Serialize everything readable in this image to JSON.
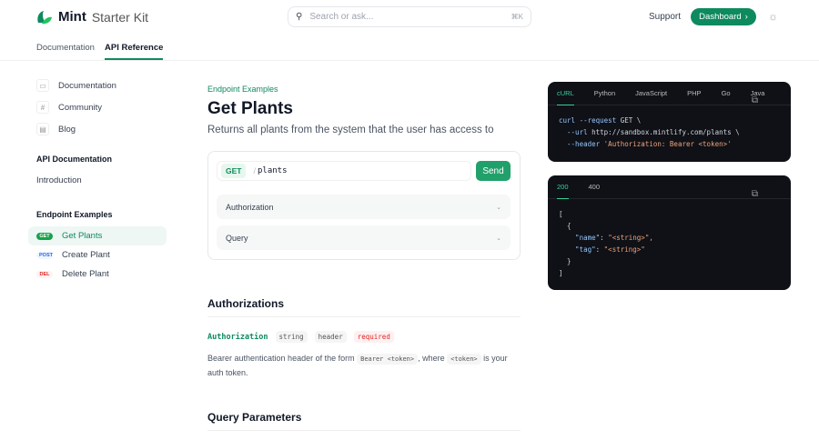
{
  "header": {
    "brand": "Mint",
    "subtitle": "Starter Kit",
    "search_placeholder": "Search or ask...",
    "search_shortcut": "⌘K",
    "support": "Support",
    "dashboard": "Dashboard",
    "dashboard_arrow": "›"
  },
  "tabs": [
    {
      "label": "Documentation"
    },
    {
      "label": "API Reference"
    }
  ],
  "sidebar": {
    "links": [
      {
        "label": "Documentation",
        "icon": "book-icon"
      },
      {
        "label": "Community",
        "icon": "slack-icon"
      },
      {
        "label": "Blog",
        "icon": "newspaper-icon"
      }
    ],
    "section1": "API Documentation",
    "intro": "Introduction",
    "section2": "Endpoint Examples",
    "endpoints": [
      {
        "method": "GET",
        "label": "Get Plants"
      },
      {
        "method": "POST",
        "label": "Create Plant"
      },
      {
        "method": "DEL",
        "label": "Delete Plant"
      }
    ]
  },
  "main": {
    "eyebrow": "Endpoint Examples",
    "title": "Get Plants",
    "description": "Returns all plants from the system that the user has access to",
    "method": "GET",
    "sep": "/",
    "path": "plants",
    "send": "Send",
    "accordions": [
      "Authorization",
      "Query"
    ],
    "auth_heading": "Authorizations",
    "param_name": "Authorization",
    "param_type": "string",
    "param_loc": "header",
    "param_req": "required",
    "desc_1": "Bearer authentication header of the form ",
    "code_1": "Bearer <token>",
    "desc_2": ", where ",
    "code_2": "<token>",
    "desc_3": " is your auth token.",
    "query_heading": "Query Parameters"
  },
  "request": {
    "tabs": [
      "cURL",
      "Python",
      "JavaScript",
      "PHP",
      "Go",
      "Java"
    ],
    "l1a": "curl --request ",
    "l1b": "GET \\",
    "l2a": "  --url ",
    "l2b": "http://sandbox.mintlify.com/plants \\",
    "l3a": "  --header ",
    "l3b": "'Authorization: Bearer <token>'"
  },
  "response": {
    "tabs": [
      "200",
      "400"
    ],
    "l1": "[",
    "l2": "  {",
    "l3k": "    \"name\"",
    "l3v": "\"<string>\",",
    "l4k": "    \"tag\"",
    "l4v": "\"<string>\"",
    "l5": "  }",
    "l6": "]",
    "colon": ": "
  },
  "colors": {
    "accent": "#0e8a5f",
    "code_bg": "#0f1117"
  }
}
